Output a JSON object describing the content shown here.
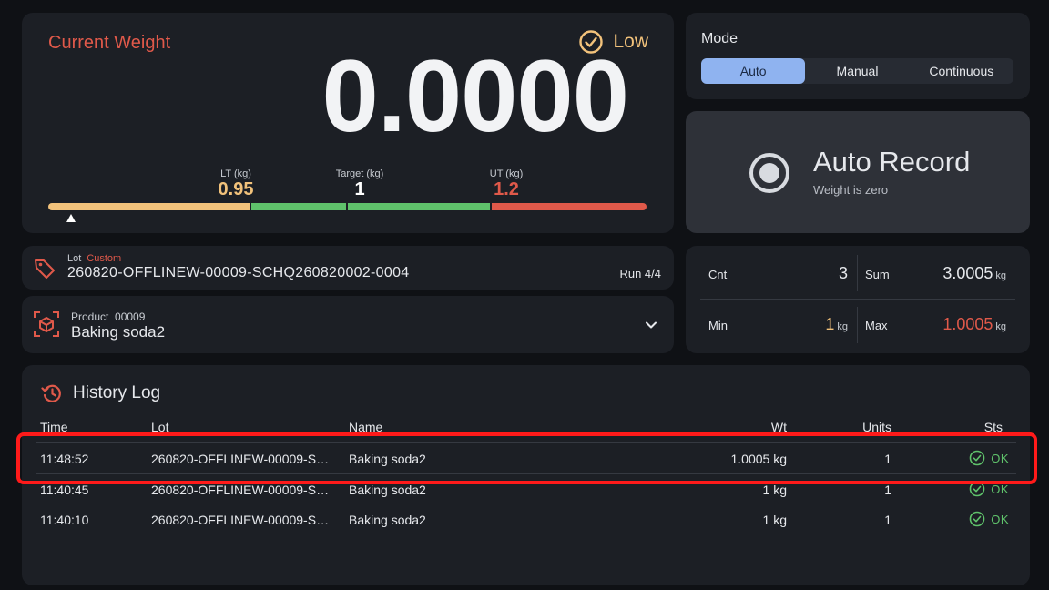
{
  "weight": {
    "title": "Current Weight",
    "status": "Low",
    "value": "0.0000",
    "lt_caption": "LT (kg)",
    "lt_value": "0.95",
    "target_caption": "Target (kg)",
    "target_value": "1",
    "ut_caption": "UT (kg)",
    "ut_value": "1.2"
  },
  "mode": {
    "title": "Mode",
    "options": [
      "Auto",
      "Manual",
      "Continuous"
    ],
    "selected": "Auto"
  },
  "record": {
    "title": "Auto Record",
    "subtitle": "Weight is zero"
  },
  "lot": {
    "caption": "Lot",
    "tag": "Custom",
    "value": "260820-OFFLINEW-00009-SCHQ260820002-0004",
    "run": "Run 4/4"
  },
  "product": {
    "caption": "Product",
    "code": "00009",
    "name": "Baking soda2"
  },
  "stats": {
    "cnt_label": "Cnt",
    "cnt_value": "3",
    "sum_label": "Sum",
    "sum_value": "3.0005",
    "sum_unit": "kg",
    "min_label": "Min",
    "min_value": "1",
    "min_unit": "kg",
    "max_label": "Max",
    "max_value": "1.0005",
    "max_unit": "kg"
  },
  "history": {
    "title": "History Log",
    "columns": [
      "Time",
      "Lot",
      "Name",
      "Wt",
      "Units",
      "Sts"
    ],
    "rows": [
      {
        "time": "11:48:52",
        "lot": "260820-OFFLINEW-00009-SCH...",
        "name": "Baking soda2",
        "wt": "1.0005 kg",
        "units": "1",
        "sts": "OK"
      },
      {
        "time": "11:40:45",
        "lot": "260820-OFFLINEW-00009-SCH...",
        "name": "Baking soda2",
        "wt": "1 kg",
        "units": "1",
        "sts": "OK"
      },
      {
        "time": "11:40:10",
        "lot": "260820-OFFLINEW-00009-SCH...",
        "name": "Baking soda2",
        "wt": "1 kg",
        "units": "1",
        "sts": "OK"
      }
    ]
  },
  "colors": {
    "accent_red": "#e0594a",
    "low_yellow": "#f2c27b",
    "ok_green": "#5fc26b",
    "mode_active": "#8fb3f0"
  },
  "icons": [
    "check-circle-icon",
    "record-icon",
    "tag-icon",
    "box-icon",
    "chevron-down-icon",
    "history-icon"
  ]
}
